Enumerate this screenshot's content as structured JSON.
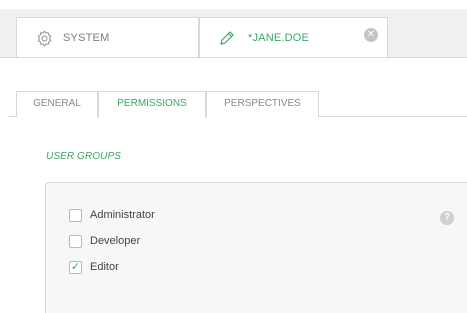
{
  "editor_tabs": [
    {
      "label": "SYSTEM",
      "icon": "gear-icon"
    },
    {
      "label": "*JANE.DOE",
      "icon": "pencil-icon",
      "close_icon": "close-icon"
    }
  ],
  "inner_tabs": [
    {
      "label": "GENERAL"
    },
    {
      "label": "PERMISSIONS",
      "active": true
    },
    {
      "label": "PERSPECTIVES"
    }
  ],
  "section": {
    "title": "USER GROUPS",
    "help_icon": "help-icon",
    "help_glyph": "?"
  },
  "user_groups": [
    {
      "label": "Administrator",
      "checked": false
    },
    {
      "label": "Developer",
      "checked": false
    },
    {
      "label": "Editor",
      "checked": true
    }
  ],
  "colors": {
    "accent": "#3aa764",
    "tab_bar_bg": "#f0f0f0",
    "border": "#d9d9d9"
  }
}
